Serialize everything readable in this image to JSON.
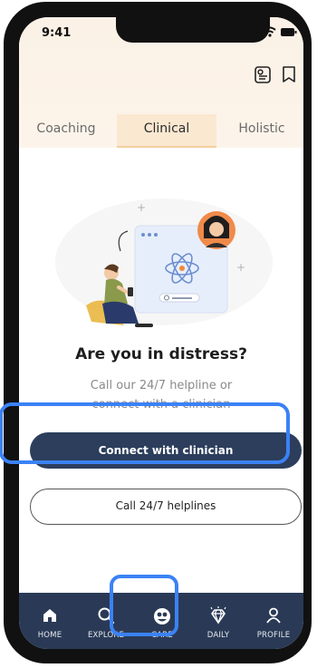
{
  "status_bar": {
    "time": "9:41"
  },
  "top_icons": {
    "left": "journal-icon",
    "right": "bookmark-icon"
  },
  "tabs": [
    {
      "label": "Coaching",
      "active": false
    },
    {
      "label": "Clinical",
      "active": true
    },
    {
      "label": "Holistic",
      "active": false
    }
  ],
  "distress": {
    "title": "Are you in distress?",
    "subtitle_line1": "Call our 24/7 helpline or",
    "subtitle_line2": "connect with a clinician"
  },
  "buttons": {
    "primary": "Connect with clinician",
    "secondary": "Call 24/7 helplines"
  },
  "bottom_nav": [
    {
      "label": "HOME",
      "icon": "home-icon"
    },
    {
      "label": "EXPLORE",
      "icon": "search-icon"
    },
    {
      "label": "CARE",
      "icon": "care-icon",
      "active": true
    },
    {
      "label": "DAILY",
      "icon": "diamond-icon"
    },
    {
      "label": "PROFILE",
      "icon": "profile-icon"
    }
  ],
  "colors": {
    "nav_background": "#2a3a56",
    "primary_button": "#2c3e5c",
    "header_tint": "#fbf1e6",
    "highlight_outline": "#3b82f6"
  }
}
